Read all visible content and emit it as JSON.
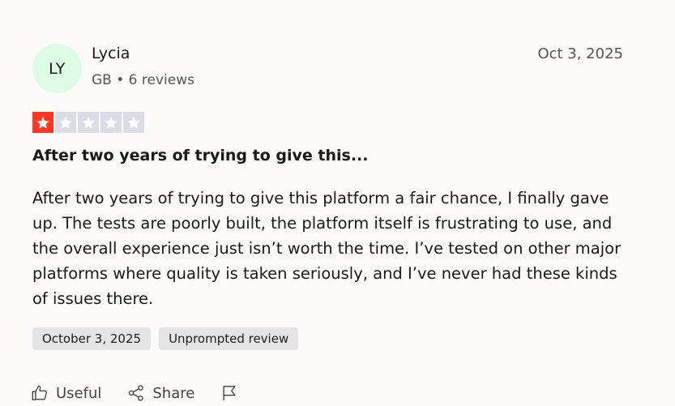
{
  "reviewer": {
    "initials": "LY",
    "name": "Lycia",
    "meta": "GB • 6 reviews"
  },
  "review": {
    "date": "Oct 3, 2025",
    "rating": 1,
    "max_rating": 5,
    "title": "After two years of trying to give this...",
    "body": "After two years of trying to give this platform a fair chance, I finally gave up. The tests are poorly built, the platform itself is frustrating to use, and the overall experience just isn’t worth the time. I’ve tested on other major platforms where quality is taken seriously, and I’ve never had these kinds of issues there.",
    "tags": [
      "October 3, 2025",
      "Unprompted review"
    ]
  },
  "actions": {
    "useful_label": "Useful",
    "share_label": "Share"
  },
  "colors": {
    "star_filled": "#ff3722",
    "star_empty": "#dcdce6",
    "avatar_bg": "#dcfce6"
  }
}
